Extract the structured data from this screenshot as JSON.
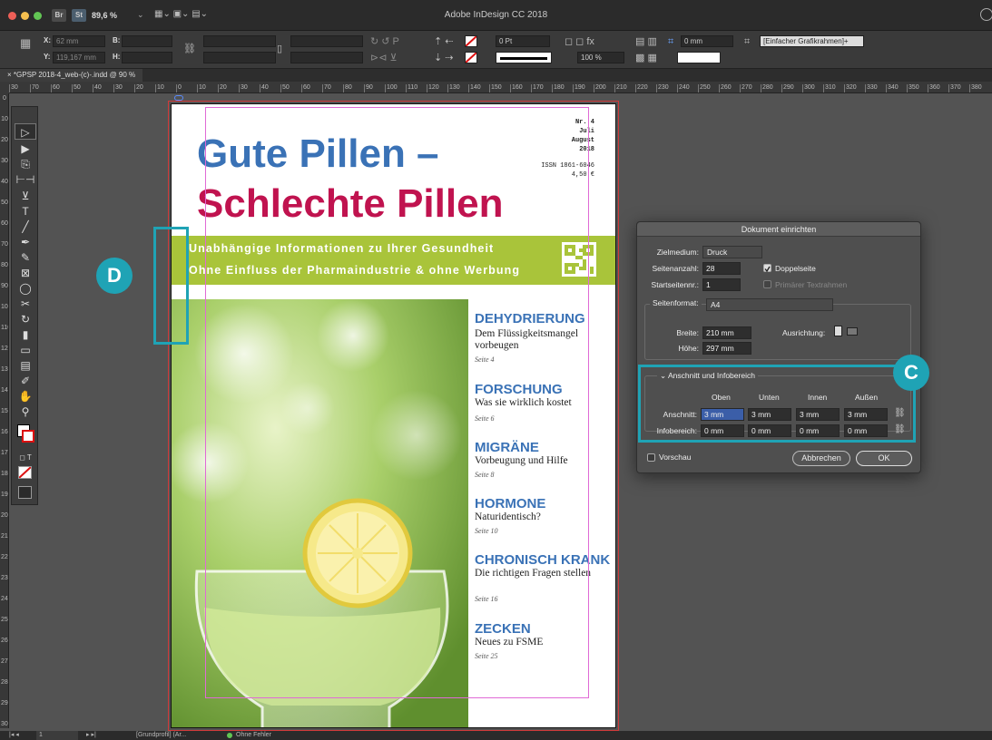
{
  "app": {
    "title": "Adobe InDesign CC 2018",
    "zoom": "89,6 %",
    "badges": [
      "Br",
      "St"
    ]
  },
  "control": {
    "x_label": "X:",
    "x_value": "62 mm",
    "y_label": "Y:",
    "y_value": "119,167 mm",
    "b_label": "B:",
    "h_label": "H:",
    "stroke_value": "0 Pt",
    "scale_value": "100 %",
    "size_value": "0 mm",
    "style_value": "[Einfacher Grafikrahmen]+"
  },
  "document": {
    "tab": "× *GPSP 2018-4_web-(c)-.indd @ 90 %"
  },
  "ruler": {
    "h": [
      "30",
      "70",
      "60",
      "50",
      "40",
      "30",
      "20",
      "10",
      "0",
      "10",
      "20",
      "30",
      "40",
      "50",
      "60",
      "70",
      "80",
      "90",
      "100",
      "110",
      "120",
      "130",
      "140",
      "150",
      "160",
      "170",
      "180",
      "190",
      "200",
      "210",
      "220",
      "230",
      "240",
      "250",
      "260",
      "270",
      "280",
      "290",
      "300",
      "310",
      "320",
      "330",
      "340",
      "350",
      "360",
      "370",
      "380"
    ],
    "v": [
      "0",
      "10",
      "20",
      "30",
      "40",
      "50",
      "60",
      "70",
      "80",
      "90",
      "100",
      "110",
      "120",
      "130",
      "140",
      "150",
      "160",
      "170",
      "180",
      "190",
      "200",
      "210",
      "220",
      "230",
      "240",
      "250",
      "260",
      "270",
      "280",
      "290",
      "300"
    ]
  },
  "magazine": {
    "issue": "Nr. 4",
    "month": "Juli",
    "month2": "August",
    "year": "2018",
    "issn": "ISSN 1861-6046",
    "price": "4,50 €",
    "title1": "Gute Pillen –",
    "title2": "Schlechte Pillen",
    "tagline1": "Unabhängige Informationen zu Ihrer Gesundheit",
    "tagline2": "Ohne Einfluss der Pharmaindustrie & ohne Werbung",
    "toc": [
      {
        "heading": "DEHYDRIERUNG",
        "sub": "Dem Flüssigkeitsmangel vorbeugen",
        "page": "Seite 4"
      },
      {
        "heading": "FORSCHUNG",
        "sub": "Was sie wirklich kostet",
        "page": "Seite 6"
      },
      {
        "heading": "MIGRÄNE",
        "sub": "Vorbeugung und Hilfe",
        "page": "Seite 8"
      },
      {
        "heading": "HORMONE",
        "sub": "Naturidentisch?",
        "page": "Seite 10"
      },
      {
        "heading": "CHRONISCH KRANK",
        "sub": "Die richtigen Fragen stellen",
        "page": "Seite 16"
      },
      {
        "heading": "ZECKEN",
        "sub": "Neues zu FSME",
        "page": "Seite 25"
      }
    ]
  },
  "dialog": {
    "title": "Dokument einrichten",
    "medium_label": "Zielmedium:",
    "medium_value": "Druck",
    "pages_label": "Seitenanzahl:",
    "pages_value": "28",
    "start_label": "Startseitennr.:",
    "start_value": "1",
    "facing_label": "Doppelseite",
    "primary_label": "Primärer Textrahmen",
    "format_label": "Seitenformat:",
    "format_value": "A4",
    "width_label": "Breite:",
    "width_value": "210 mm",
    "height_label": "Höhe:",
    "height_value": "297 mm",
    "orient_label": "Ausrichtung:",
    "section_label": "Anschnitt und Infobereich",
    "cols": [
      "Oben",
      "Unten",
      "Innen",
      "Außen"
    ],
    "bleed_label": "Anschnitt:",
    "bleed_values": [
      "3 mm",
      "3 mm",
      "3 mm",
      "3 mm"
    ],
    "slug_label": "Infobereich:",
    "slug_values": [
      "0 mm",
      "0 mm",
      "0 mm",
      "0 mm"
    ],
    "preview_label": "Vorschau",
    "cancel_label": "Abbrechen",
    "ok_label": "OK"
  },
  "callouts": {
    "c": "C",
    "d": "D"
  },
  "status": {
    "page": "1",
    "master": "[Grundprofil] (Ar...",
    "errors": "Ohne Fehler"
  },
  "colors": {
    "blue": "#3a72b6",
    "crimson": "#c0134f",
    "green": "#a9c43a",
    "callout": "#1fa3b5"
  }
}
